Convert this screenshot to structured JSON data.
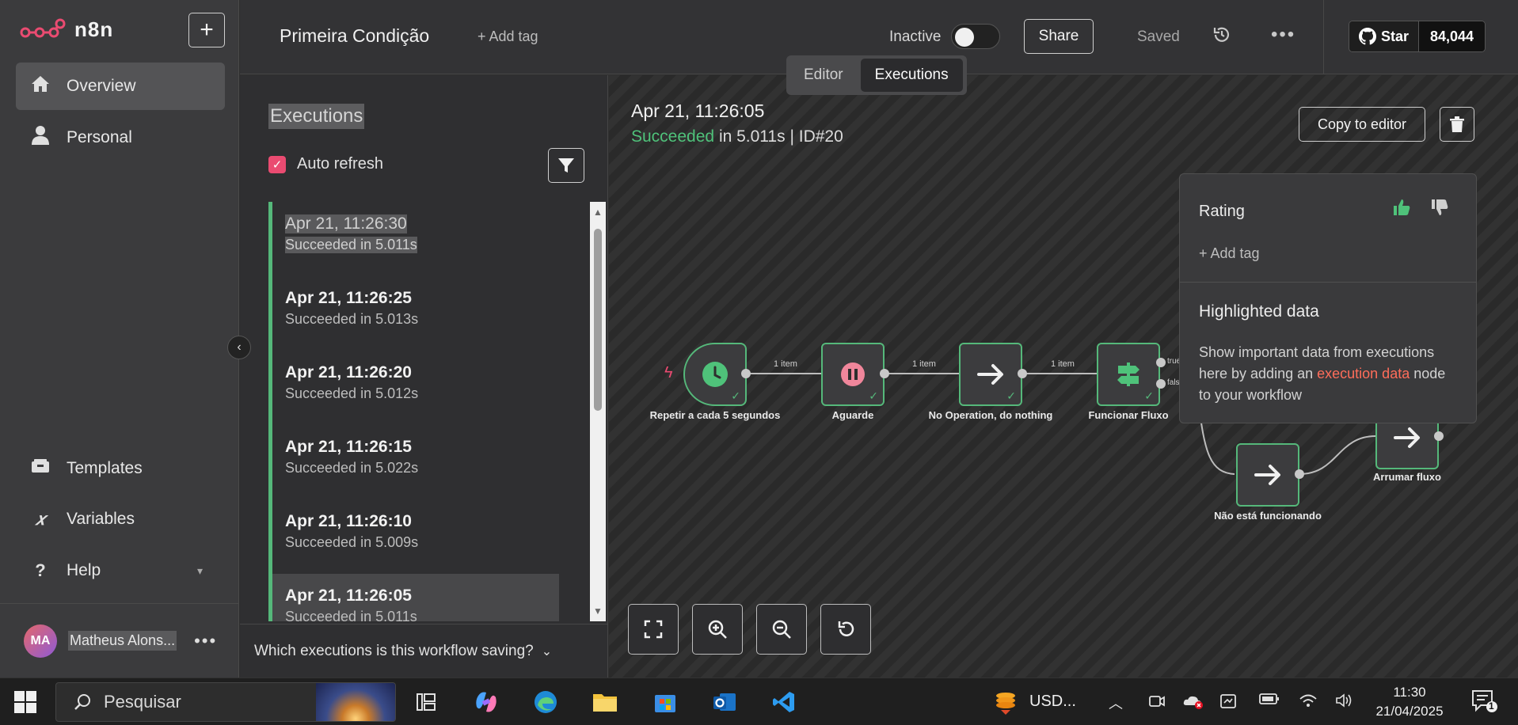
{
  "app": {
    "name": "n8n"
  },
  "sidebar": {
    "items": [
      {
        "label": "Overview",
        "icon": "home-icon"
      },
      {
        "label": "Personal",
        "icon": "user-icon"
      },
      {
        "label": "Templates",
        "icon": "box-icon"
      },
      {
        "label": "Variables",
        "icon": "variables-icon"
      },
      {
        "label": "Help",
        "icon": "help-icon"
      }
    ],
    "user": {
      "initials": "MA",
      "name": "Matheus Alons..."
    }
  },
  "header": {
    "workflow_name": "Primeira Condição",
    "add_tag": "+ Add tag",
    "inactive_label": "Inactive",
    "share_label": "Share",
    "saved_label": "Saved",
    "github_star": "Star",
    "github_count": "84,044"
  },
  "tabs": [
    {
      "label": "Editor",
      "active": false
    },
    {
      "label": "Executions",
      "active": true
    }
  ],
  "executions": {
    "title": "Executions",
    "auto_refresh": "Auto refresh",
    "items": [
      {
        "time": "Apr 21, 11:26:30",
        "status": "Succeeded in 5.011s"
      },
      {
        "time": "Apr 21, 11:26:25",
        "status": "Succeeded in 5.013s"
      },
      {
        "time": "Apr 21, 11:26:20",
        "status": "Succeeded in 5.012s"
      },
      {
        "time": "Apr 21, 11:26:15",
        "status": "Succeeded in 5.022s"
      },
      {
        "time": "Apr 21, 11:26:10",
        "status": "Succeeded in 5.009s"
      },
      {
        "time": "Apr 21, 11:26:05",
        "status": "Succeeded in 5.011s"
      }
    ],
    "saving_question": "Which executions is this workflow saving?"
  },
  "detail": {
    "time": "Apr 21, 11:26:05",
    "status_word": "Succeeded",
    "status_rest": "in 5.011s | ID#20",
    "copy_label": "Copy to editor"
  },
  "nodes": [
    {
      "label": "Repetir a cada 5 segundos",
      "icon": "clock-icon"
    },
    {
      "label": "Aguarde",
      "icon": "pause-icon"
    },
    {
      "label": "No Operation, do nothing",
      "icon": "arrow-right-icon"
    },
    {
      "label": "Funcionar Fluxo",
      "icon": "signpost-icon"
    },
    {
      "label": "Não está funcionando",
      "icon": "arrow-right-icon"
    },
    {
      "label": "Arrumar fluxo",
      "icon": "arrow-right-icon"
    }
  ],
  "edges": {
    "item_label": "1 item",
    "true_label": "true",
    "false_label": "false"
  },
  "rating": {
    "title": "Rating",
    "add_tag": "+ Add tag",
    "highlight_title": "Highlighted data",
    "highlight_text_1": "Show important data from executions here by adding an ",
    "highlight_link": "execution data",
    "highlight_text_2": " node to your workflow"
  },
  "taskbar": {
    "search": "Pesquisar",
    "usd": "USD...",
    "time": "11:30",
    "date": "21/04/2025",
    "notif_count": "1"
  },
  "colors": {
    "accent": "#ea4b71",
    "success": "#55b87a",
    "link": "#ff6d5a"
  }
}
